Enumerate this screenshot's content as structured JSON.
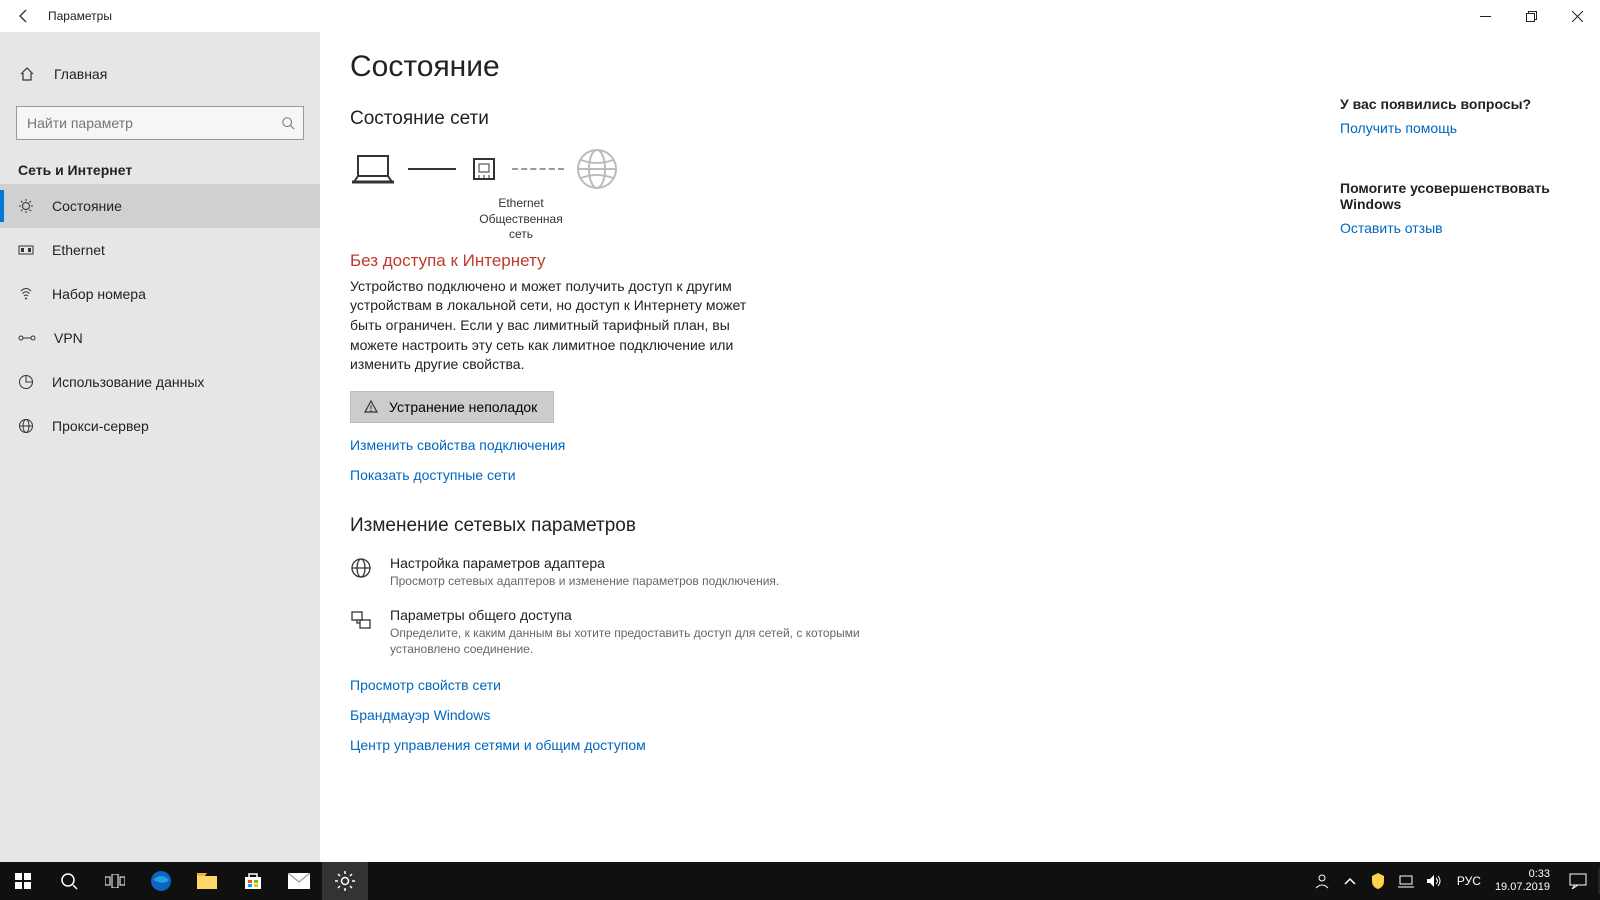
{
  "window": {
    "title": "Параметры"
  },
  "sidebar": {
    "home": "Главная",
    "search_placeholder": "Найти параметр",
    "group": "Сеть и Интернет",
    "items": [
      {
        "label": "Состояние",
        "icon": "status-icon"
      },
      {
        "label": "Ethernet",
        "icon": "ethernet-icon"
      },
      {
        "label": "Набор номера",
        "icon": "dialup-icon"
      },
      {
        "label": "VPN",
        "icon": "vpn-icon"
      },
      {
        "label": "Использование данных",
        "icon": "data-usage-icon"
      },
      {
        "label": "Прокси-сервер",
        "icon": "proxy-icon"
      }
    ]
  },
  "main": {
    "heading": "Состояние",
    "subheading": "Состояние сети",
    "diagram": {
      "adapter_name": "Ethernet",
      "network_type": "Общественная сеть"
    },
    "warning_title": "Без доступа к Интернету",
    "warning_desc": "Устройство подключено и может получить доступ к другим устройствам в локальной сети, но доступ к Интернету может быть ограничен. Если у вас лимитный тарифный план, вы можете настроить эту сеть как лимитное подключение или изменить другие свойства.",
    "troubleshoot_label": "Устранение неполадок",
    "link_change_props": "Изменить свойства подключения",
    "link_show_nets": "Показать доступные сети",
    "section2_heading": "Изменение сетевых параметров",
    "opt_adapter": {
      "title": "Настройка параметров адаптера",
      "desc": "Просмотр сетевых адаптеров и изменение параметров подключения."
    },
    "opt_sharing": {
      "title": "Параметры общего доступа",
      "desc": "Определите, к каким данным вы хотите предоставить доступ для сетей, с которыми установлено соединение."
    },
    "link_net_props": "Просмотр свойств сети",
    "link_firewall": "Брандмауэр Windows",
    "link_sharing_center": "Центр управления сетями и общим доступом"
  },
  "right": {
    "q_heading": "У вас появились вопросы?",
    "q_link": "Получить помощь",
    "fb_heading": "Помогите усовершенствовать Windows",
    "fb_link": "Оставить отзыв"
  },
  "taskbar": {
    "lang": "РУС",
    "time": "0:33",
    "date": "19.07.2019"
  }
}
